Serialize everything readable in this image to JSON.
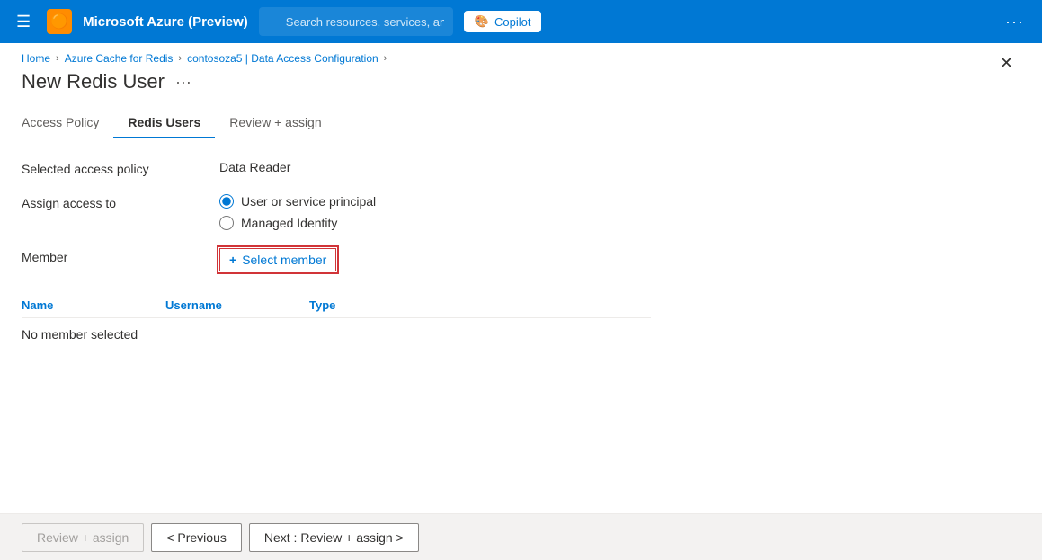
{
  "topbar": {
    "hamburger_icon": "☰",
    "title": "Microsoft Azure (Preview)",
    "icon_emoji": "🟠",
    "search_placeholder": "Search resources, services, and docs (G+/)",
    "copilot_label": "Copilot",
    "more_icon": "···"
  },
  "breadcrumb": {
    "items": [
      {
        "label": "Home",
        "sep": "›"
      },
      {
        "label": "Azure Cache for Redis",
        "sep": "›"
      },
      {
        "label": "contosoza5 | Data Access Configuration",
        "sep": "›"
      }
    ]
  },
  "page": {
    "title": "New Redis User",
    "more_icon": "···",
    "close_icon": "✕"
  },
  "tabs": [
    {
      "id": "access-policy",
      "label": "Access Policy"
    },
    {
      "id": "redis-users",
      "label": "Redis Users",
      "active": true
    },
    {
      "id": "review-assign",
      "label": "Review + assign"
    }
  ],
  "form": {
    "selected_access_policy_label": "Selected access policy",
    "selected_access_policy_value": "Data Reader",
    "assign_access_label": "Assign access to",
    "radio_options": [
      {
        "id": "user-service",
        "label": "User or service principal",
        "checked": true
      },
      {
        "id": "managed-identity",
        "label": "Managed Identity",
        "checked": false
      }
    ],
    "member_label": "Member",
    "select_member_plus": "+",
    "select_member_label": "Select member",
    "table_headers": {
      "name": "Name",
      "username": "Username",
      "type": "Type"
    },
    "table_empty": "No member selected"
  },
  "footer": {
    "review_assign_label": "Review + assign",
    "previous_label": "< Previous",
    "next_label": "Next : Review + assign >"
  }
}
